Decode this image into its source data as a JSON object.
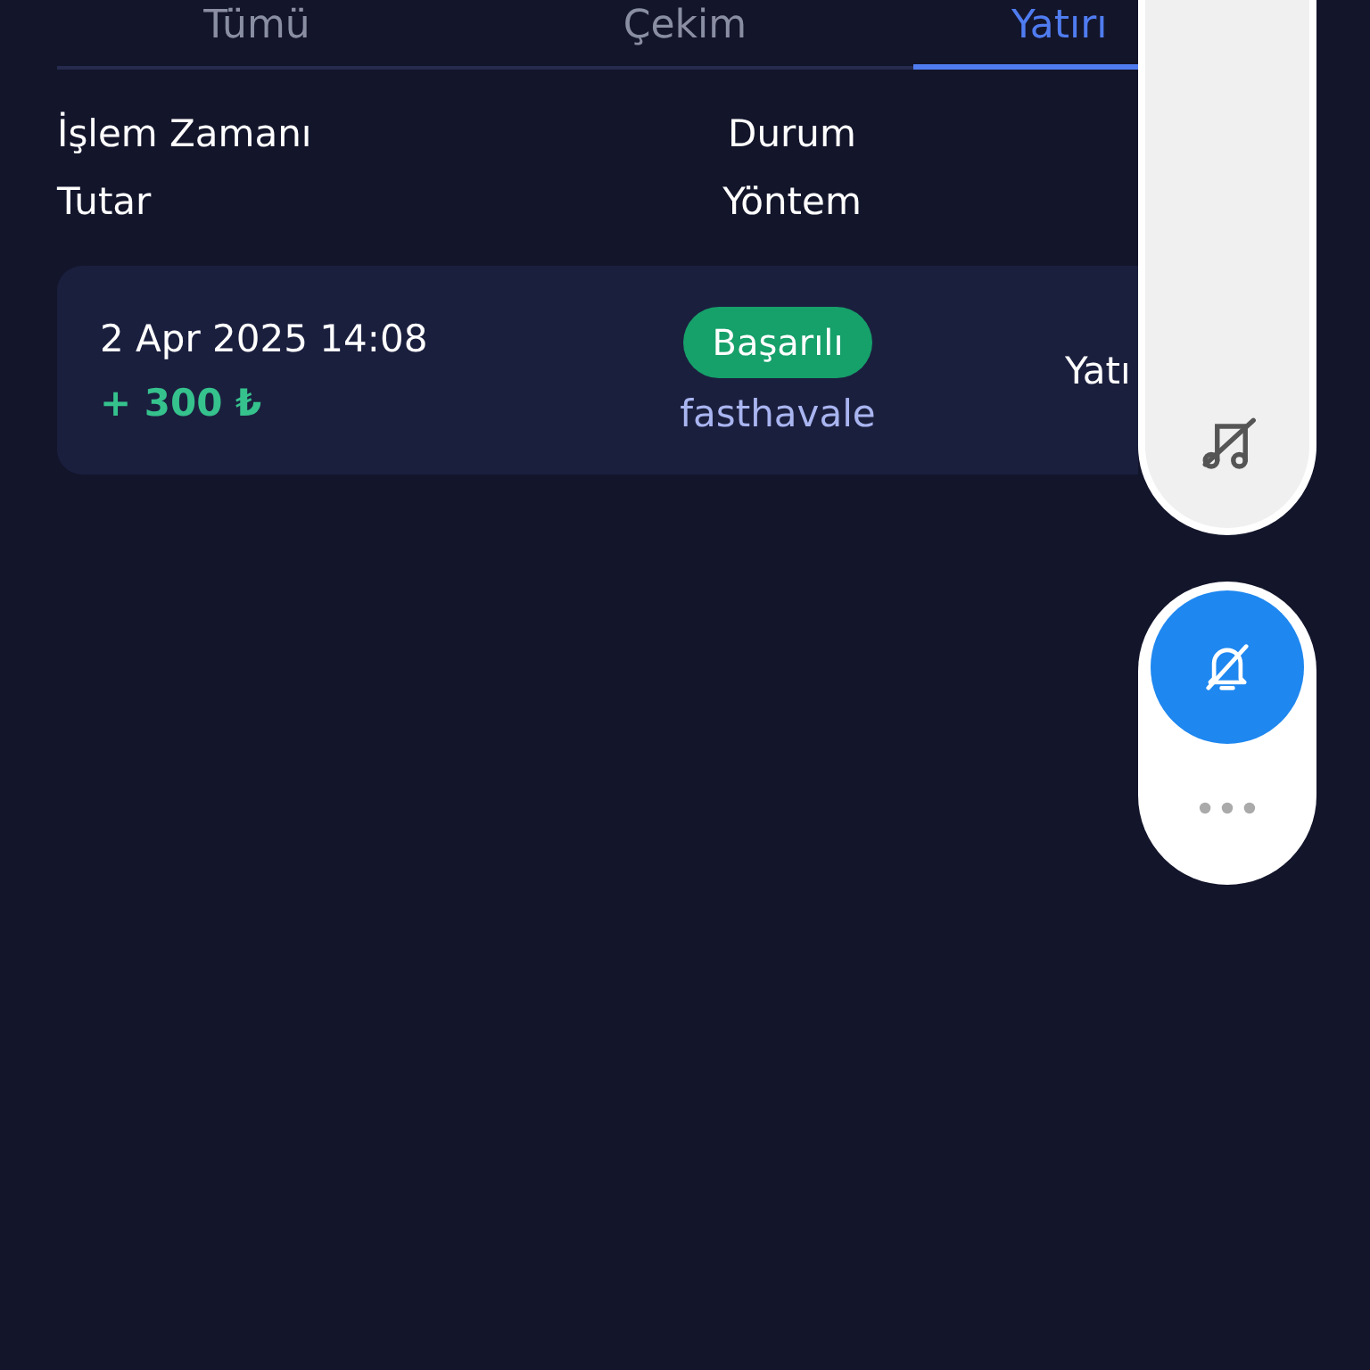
{
  "tabs": [
    {
      "label": "Tümü",
      "selected": false
    },
    {
      "label": "Çekim",
      "selected": false
    },
    {
      "label": "Yatırı",
      "selected": true
    }
  ],
  "header": {
    "col1": [
      "İşlem Zamanı",
      "Tutar"
    ],
    "col2": [
      "Durum",
      "Yöntem"
    ]
  },
  "rows": [
    {
      "time": "2 Apr 2025 14:08",
      "amount": "+ 300 ₺",
      "status": "Başarılı",
      "method": "fasthavale",
      "type": "Yatı"
    }
  ],
  "floating_panel": {
    "music_muted": true,
    "notifications_muted": true
  }
}
